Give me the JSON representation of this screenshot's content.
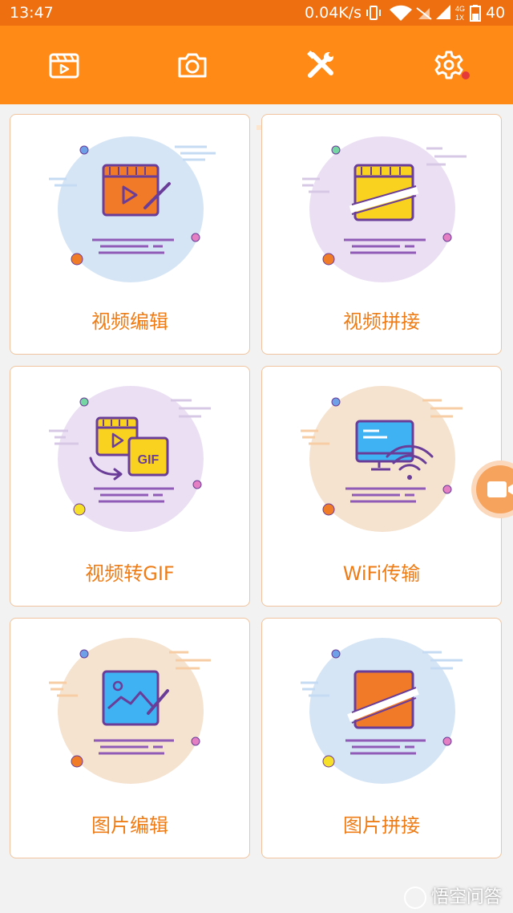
{
  "status_bar": {
    "time": "13:47",
    "net_speed": "0.04K/s",
    "signal_labels": [
      "4G",
      "1X"
    ],
    "battery": "40"
  },
  "top_tabs": [
    {
      "name": "video-clip-icon",
      "selected": false
    },
    {
      "name": "camera-icon",
      "selected": false
    },
    {
      "name": "tools-icon",
      "selected": true
    },
    {
      "name": "settings-icon",
      "selected": false,
      "badge": true
    }
  ],
  "cards": [
    {
      "label": "视频编辑"
    },
    {
      "label": "视频拼接"
    },
    {
      "label": "视频转GIF"
    },
    {
      "label": "WiFi传输"
    },
    {
      "label": "图片编辑"
    },
    {
      "label": "图片拼接"
    }
  ],
  "illustration_texts": {
    "gif": "GIF"
  },
  "watermark": {
    "text": "悟空问答"
  },
  "colors": {
    "primary": "#ff8a16",
    "status_bar": "#ee6f10",
    "label": "#ef7d17",
    "badge": "#e53a3a"
  }
}
